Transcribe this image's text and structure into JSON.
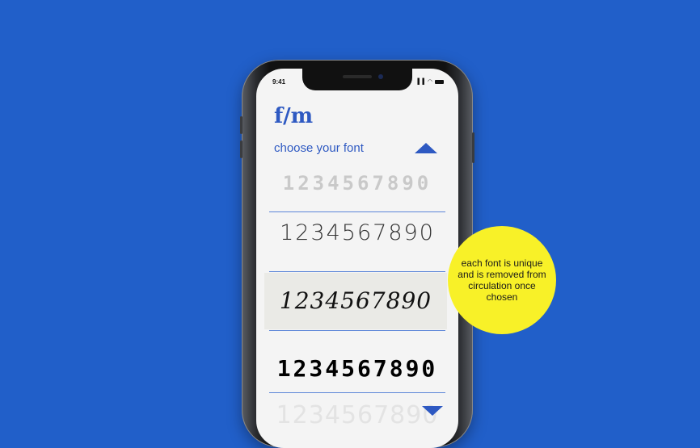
{
  "status_bar": {
    "time": "9:41",
    "icons": "▐▐ ◠"
  },
  "app": {
    "logo": "f/m",
    "subtitle": "choose your font"
  },
  "font_options": [
    {
      "label": "1234567890",
      "selected": false
    },
    {
      "label": "1234567890",
      "selected": false
    },
    {
      "label": "1234567890",
      "selected": true
    },
    {
      "label": "1234567890",
      "selected": false
    },
    {
      "label": "1234567890",
      "selected": false
    }
  ],
  "callout": {
    "text": "each font is unique and is removed from circulation once chosen"
  },
  "colors": {
    "background": "#215fc9",
    "accent": "#2e59c2",
    "callout": "#f8f128",
    "selected_row": "#eaeae6"
  },
  "icons": {
    "scroll_up": "triangle-up-icon",
    "scroll_down": "triangle-down-icon"
  }
}
